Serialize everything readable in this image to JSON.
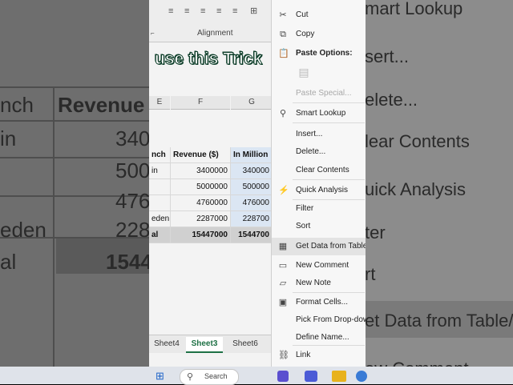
{
  "overlay_text": "use this Trick",
  "ribbon": {
    "group_label": "Alignment"
  },
  "columns": {
    "e": "E",
    "f": "F",
    "g": "G"
  },
  "table": {
    "headers": [
      "nch",
      "Revenue ($)",
      "In Million"
    ],
    "rows": [
      [
        "in",
        "3400000",
        "340000"
      ],
      [
        "",
        "5000000",
        "500000"
      ],
      [
        "",
        "4760000",
        "476000"
      ],
      [
        "eden",
        "2287000",
        "228700"
      ]
    ],
    "total": [
      "al",
      "15447000",
      "1544700"
    ]
  },
  "sheet_tabs": [
    {
      "label": "Sheet4",
      "active": false
    },
    {
      "label": "Sheet3",
      "active": true
    },
    {
      "label": "Sheet6",
      "active": false
    }
  ],
  "taskbar": {
    "search_label": "Search"
  },
  "context_menu": {
    "cut": "Cut",
    "copy": "Copy",
    "paste_options": "Paste Options:",
    "paste_special": "Paste Special...",
    "smart_lookup": "Smart Lookup",
    "insert": "Insert...",
    "delete": "Delete...",
    "clear_contents": "Clear Contents",
    "quick_analysis": "Quick Analysis",
    "filter": "Filter",
    "sort": "Sort",
    "get_data": "Get Data from Table/",
    "new_comment": "New Comment",
    "new_note": "New Note",
    "format_cells": "Format Cells...",
    "pick_dropdown": "Pick From Drop-dow",
    "define_name": "Define Name...",
    "link": "Link"
  },
  "background_left": {
    "header": "nch",
    "revenue": "Revenue",
    "rows": [
      "in",
      "eden",
      "al"
    ]
  },
  "background_values": [
    "340",
    "500",
    "476",
    "228",
    "1544"
  ],
  "background_right": {
    "items": [
      "mart Lookup",
      "sert...",
      "elete...",
      "lear Contents",
      "uick Analysis",
      "ter",
      "rt",
      "et Data from Table/",
      "ew Comment"
    ]
  },
  "colors": {
    "accent": "#1e7145",
    "overlay_stroke": "#0c3d28",
    "menu_bg": "#f7f7f7"
  }
}
